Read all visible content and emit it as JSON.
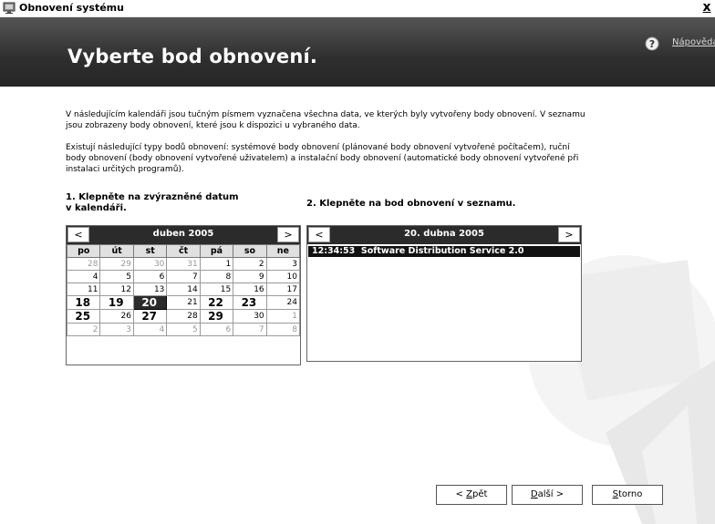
{
  "window": {
    "title": "Obnovení systému",
    "close_label": "x"
  },
  "header": {
    "title": "Vyberte bod obnovení.",
    "help_link": "Nápověda"
  },
  "intro": {
    "paragraph1": "V následujícím kalendáři jsou tučným písmem vyznačena všechna data, ve kterých byly vytvořeny body obnovení. V seznamu jsou zobrazeny body obnovení, které jsou k dispozici u vybraného data.",
    "paragraph2": "Existují následující typy bodů obnovení: systémové body obnovení (plánované body obnovení vytvořené počítačem), ruční body obnovení (body obnovení vytvořené uživatelem) a instalační body obnovení (automatické body obnovení vytvořené při instalaci určitých programů)."
  },
  "steps": {
    "step1": "1. Klepněte na zvýrazněné datum v kalendáři.",
    "step2": "2. Klepněte na bod obnovení v seznamu."
  },
  "calendar": {
    "month_label": "duben 2005",
    "prev_label": "<",
    "next_label": ">",
    "weekdays": [
      "po",
      "út",
      "st",
      "čt",
      "pá",
      "so",
      "ne"
    ],
    "weeks": [
      [
        {
          "d": "28",
          "t": "other"
        },
        {
          "d": "29",
          "t": "other"
        },
        {
          "d": "30",
          "t": "other"
        },
        {
          "d": "31",
          "t": "other"
        },
        {
          "d": "1",
          "t": ""
        },
        {
          "d": "2",
          "t": ""
        },
        {
          "d": "3",
          "t": ""
        }
      ],
      [
        {
          "d": "4",
          "t": ""
        },
        {
          "d": "5",
          "t": ""
        },
        {
          "d": "6",
          "t": ""
        },
        {
          "d": "7",
          "t": ""
        },
        {
          "d": "8",
          "t": ""
        },
        {
          "d": "9",
          "t": ""
        },
        {
          "d": "10",
          "t": ""
        }
      ],
      [
        {
          "d": "11",
          "t": ""
        },
        {
          "d": "12",
          "t": ""
        },
        {
          "d": "13",
          "t": ""
        },
        {
          "d": "14",
          "t": ""
        },
        {
          "d": "15",
          "t": ""
        },
        {
          "d": "16",
          "t": ""
        },
        {
          "d": "17",
          "t": ""
        }
      ],
      [
        {
          "d": "18",
          "t": "bold"
        },
        {
          "d": "19",
          "t": "bold"
        },
        {
          "d": "20",
          "t": "selected"
        },
        {
          "d": "21",
          "t": ""
        },
        {
          "d": "22",
          "t": "bold"
        },
        {
          "d": "23",
          "t": "bold"
        },
        {
          "d": "24",
          "t": ""
        }
      ],
      [
        {
          "d": "25",
          "t": "bold"
        },
        {
          "d": "26",
          "t": ""
        },
        {
          "d": "27",
          "t": "bold"
        },
        {
          "d": "28",
          "t": ""
        },
        {
          "d": "29",
          "t": "bold"
        },
        {
          "d": "30",
          "t": ""
        },
        {
          "d": "1",
          "t": "other"
        }
      ],
      [
        {
          "d": "2",
          "t": "other"
        },
        {
          "d": "3",
          "t": "other"
        },
        {
          "d": "4",
          "t": "other"
        },
        {
          "d": "5",
          "t": "other"
        },
        {
          "d": "6",
          "t": "other"
        },
        {
          "d": "7",
          "t": "other"
        },
        {
          "d": "8",
          "t": "other"
        }
      ]
    ]
  },
  "restore_points": {
    "date_label": "20. dubna 2005",
    "prev_label": "<",
    "next_label": ">",
    "items": [
      {
        "time": "12:34:53",
        "description": "Software Distribution Service 2.0"
      }
    ]
  },
  "buttons": {
    "back": {
      "prefix": "< ",
      "accel": "Z",
      "rest": "pět"
    },
    "next": {
      "accel": "D",
      "rest": "alší",
      "suffix": " >"
    },
    "cancel": {
      "accel": "S",
      "rest": "torno"
    }
  },
  "icons": {
    "app": "system-restore-icon",
    "help": "question-mark-icon",
    "watermark": "restore-arrow-icon"
  }
}
